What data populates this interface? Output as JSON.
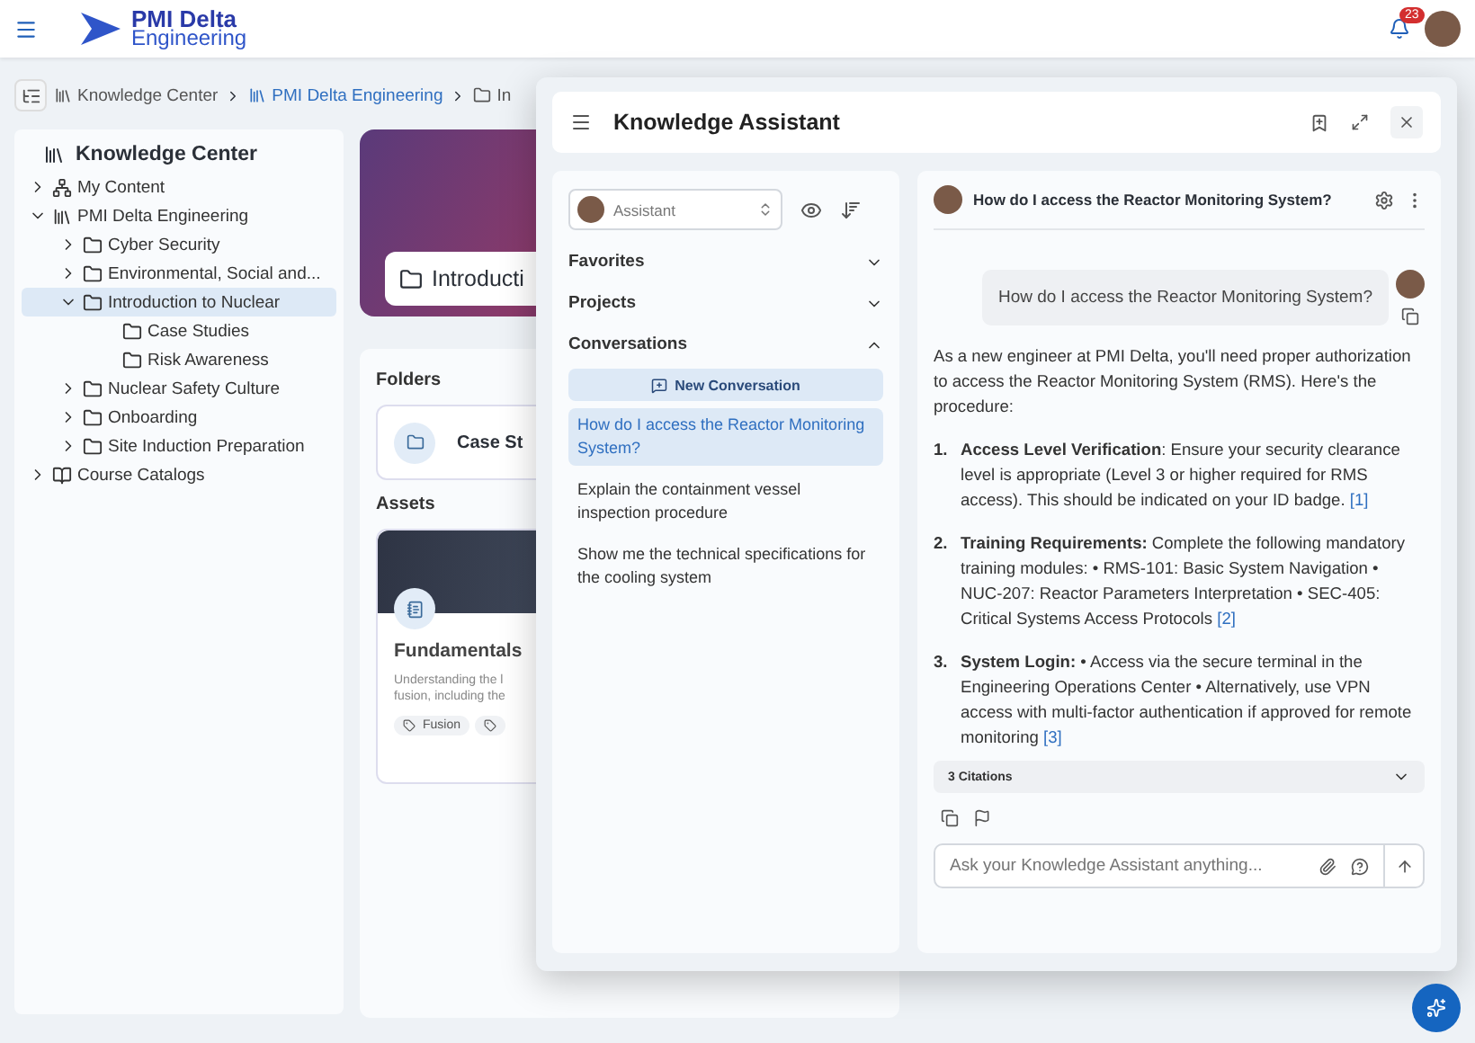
{
  "header": {
    "logo_line_1": "PMI Delta",
    "logo_line_2": "Engineering",
    "notifications": "23"
  },
  "breadcrumb": [
    {
      "label": "Knowledge Center",
      "kind": "library",
      "selected": false
    },
    {
      "label": "PMI Delta Engineering",
      "kind": "library",
      "selected": true
    },
    {
      "label": "In",
      "kind": "folder",
      "selected": false
    }
  ],
  "sidebar": {
    "title": "Knowledge Center",
    "items": [
      {
        "label": "My Content",
        "kind": "hierarchy",
        "expanded": false,
        "selected": false
      },
      {
        "label": "PMI Delta Engineering",
        "kind": "library",
        "expanded": true,
        "selected": false,
        "children": [
          {
            "label": "Cyber Security",
            "kind": "folder",
            "expanded": false,
            "selected": false
          },
          {
            "label": "Environmental, Social and...",
            "kind": "folder",
            "expanded": false,
            "selected": false
          },
          {
            "label": "Introduction to Nuclear",
            "kind": "folder",
            "expanded": true,
            "selected": true,
            "children": [
              {
                "label": "Case Studies",
                "kind": "leaf",
                "expanded": false,
                "selected": false
              },
              {
                "label": "Risk Awareness",
                "kind": "leaf",
                "expanded": false,
                "selected": false
              }
            ]
          },
          {
            "label": "Nuclear Safety Culture",
            "kind": "folder",
            "expanded": false,
            "selected": false
          },
          {
            "label": "Onboarding",
            "kind": "folder",
            "expanded": false,
            "selected": false
          },
          {
            "label": "Site Induction Preparation",
            "kind": "folder",
            "expanded": false,
            "selected": false
          }
        ]
      },
      {
        "label": "Course Catalogs",
        "kind": "book",
        "expanded": false,
        "selected": false
      }
    ]
  },
  "content": {
    "title": "Introducti",
    "folders_heading": "Folders",
    "folders": [
      "Case St"
    ],
    "assets_heading": "Assets",
    "assets": [
      {
        "title": "Fundamentals",
        "description": "Understanding the l fusion, including the",
        "tags": [
          {
            "kind": "labeled",
            "label": "Fusion"
          },
          {
            "kind": "icon_only"
          }
        ]
      }
    ]
  },
  "assistant": {
    "title": "Knowledge Assistant",
    "persona": "Assistant",
    "sections": [
      {
        "label": "Favorites",
        "expanded": false
      },
      {
        "label": "Projects",
        "expanded": false
      },
      {
        "label": "Conversations",
        "expanded": true
      }
    ],
    "new_conversation": "New Conversation",
    "conversations": [
      {
        "label": "How do I access the Reactor Monitoring System?",
        "selected": true
      },
      {
        "label": "Explain the containment vessel inspection procedure",
        "selected": false
      },
      {
        "label": "Show me the technical specifications for the cooling system",
        "selected": false
      }
    ],
    "chat_title": "How do I access the Reactor Monitoring System?",
    "user_message": "How do I access the Reactor Monitoring System?",
    "answer_intro": "As a new engineer at PMI Delta, you'll need proper authorization to access the Reactor Monitoring System (RMS). Here's the procedure:",
    "steps": [
      {
        "number": "1.",
        "text": "**Access Level Verification**: Ensure your security clearance level is appropriate (Level 3 or higher required for RMS access). This should be indicated on your ID badge.",
        "citation": "[1]"
      },
      {
        "number": "2.",
        "text": "**Training Requirements:** Complete the following mandatory training modules: • RMS-101: Basic System Navigation • NUC-207: Reactor Parameters Interpretation • SEC-405: Critical Systems Access Protocols",
        "citation": "[2]"
      },
      {
        "number": "3.",
        "text": "**System Login:** • Access via the secure terminal in the Engineering Operations Center • Alternatively, use VPN access with multi-factor authentication if approved for remote monitoring",
        "citation": "[3]"
      }
    ],
    "citations": {
      "label": "3 Citations",
      "expanded": false
    },
    "input": {
      "placeholder": "Ask your Knowledge Assistant anything..."
    }
  }
}
